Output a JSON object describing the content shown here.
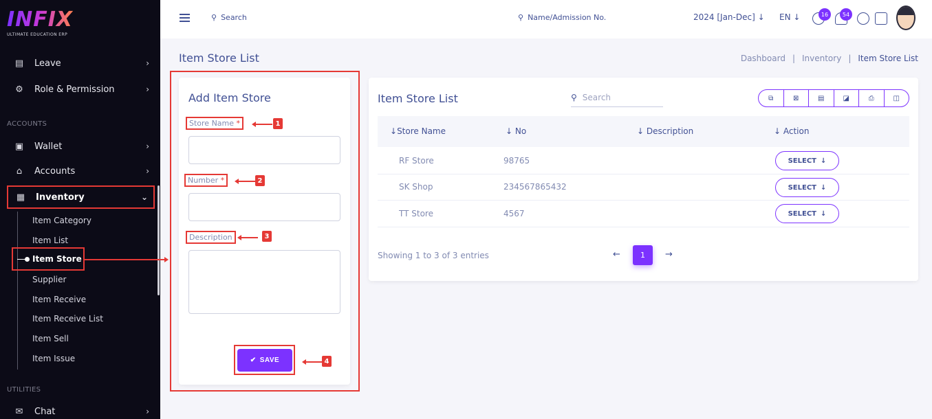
{
  "brand": {
    "name": "INFIX",
    "tagline": "ULTIMATE EDUCATION ERP"
  },
  "sidebar": {
    "top_items": [
      {
        "label": "Leave",
        "icon": "leave-icon"
      },
      {
        "label": "Role & Permission",
        "icon": "role-permission-icon"
      }
    ],
    "section_accounts": "ACCOUNTS",
    "account_items": [
      {
        "label": "Wallet",
        "icon": "wallet-icon"
      },
      {
        "label": "Accounts",
        "icon": "bank-icon"
      },
      {
        "label": "Inventory",
        "icon": "inventory-icon"
      }
    ],
    "inventory_sub": [
      "Item Category",
      "Item List",
      "Item Store",
      "Supplier",
      "Item Receive",
      "Item Receive List",
      "Item Sell",
      "Item Issue"
    ],
    "section_utilities": "UTILITIES",
    "utility_items": [
      {
        "label": "Chat",
        "icon": "chat-icon"
      }
    ]
  },
  "header": {
    "search_label": "Search",
    "name_search_label": "Name/Admission No.",
    "year": "2024 [Jan-Dec]",
    "lang": "EN",
    "messages_badge": "16",
    "notifications_badge": "54"
  },
  "page": {
    "title": "Item Store List",
    "breadcrumb": [
      "Dashboard",
      "Inventory",
      "Item Store List"
    ]
  },
  "add_form": {
    "title": "Add Item Store",
    "store_name_label": "Store Name",
    "number_label": "Number",
    "description_label": "Description",
    "required_mark": "*",
    "save_label": "SAVE",
    "callouts": [
      "1",
      "2",
      "3",
      "4"
    ]
  },
  "list": {
    "title": "Item Store List",
    "search_placeholder": "Search",
    "columns": [
      "Store Name",
      "No",
      "Description",
      "Action"
    ],
    "rows": [
      {
        "store": "RF Store",
        "no": "98765",
        "description": "",
        "action": "SELECT"
      },
      {
        "store": "SK Shop",
        "no": "234567865432",
        "description": "",
        "action": "SELECT"
      },
      {
        "store": "TT Store",
        "no": "4567",
        "description": "",
        "action": "SELECT"
      }
    ],
    "showing": "Showing 1 to 3 of 3 entries",
    "current_page": "1"
  },
  "colors": {
    "accent": "#7c32ff",
    "text": "#415094",
    "callout": "#e53935",
    "sidebar_bg": "#0c0b17"
  }
}
